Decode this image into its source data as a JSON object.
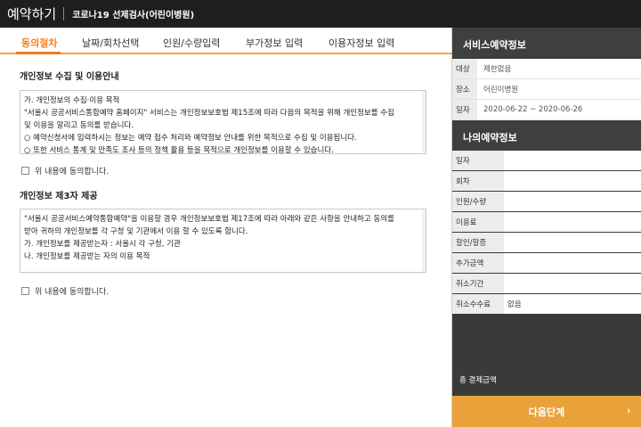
{
  "header": {
    "title": "예약하기",
    "subtitle": "코로나19 선제검사(어린이병원)"
  },
  "tabs": [
    {
      "label": "동의절차",
      "active": true
    },
    {
      "label": "날짜/회차선택",
      "active": false
    },
    {
      "label": "인원/수량입력",
      "active": false
    },
    {
      "label": "부가정보 입력",
      "active": false
    },
    {
      "label": "이용자정보 입력",
      "active": false
    }
  ],
  "consent1": {
    "title": "개인정보 수집 및 이용안내",
    "lines": [
      "가. 개인정보의 수집·이용 목적",
      "\"서울시 공공서비스통합예약 홈페이지\" 서비스는 개인정보보호법 제15조에 따라 다음의 목적을 위해 개인정보를 수집",
      "및 이용을 알리고 동의를 받습니다.",
      "",
      "○ 예약신청서에 입력하시는 정보는 예약 접수 처리와 예약정보 안내를 위한 목적으로 수집 및 이용됩니다.",
      "○ 또한 서비스 통계 및 만족도 조사 등의 정책 활용 등을 목적으로 개인정보를 이용할 수 있습니다."
    ],
    "agree_label": "위 내용에 동의합니다."
  },
  "consent2": {
    "title": "개인정보 제3자 제공",
    "lines": [
      "\"서울시 공공서비스예약통합예약\"을 이용할 경우 개인정보보호법 제17조에 따라 아래와 같은 사항을 안내하고 동의를",
      "받아 귀하의 개인정보를 각 구청 및 기관에서 이용 할 수 있도록 합니다.",
      "",
      "가. 개인정보를 제공받는자 : 서울시 각 구청, 기관",
      "",
      "나. 개인정보를 제공받는 자의 이용 목적"
    ],
    "agree_label": "위 내용에 동의합니다."
  },
  "service_info": {
    "title": "서비스예약정보",
    "rows": [
      {
        "key": "대상",
        "value": "제한없음"
      },
      {
        "key": "장소",
        "value": "어린이병원"
      },
      {
        "key": "일자",
        "value": "2020-06-22 ~ 2020-06-26"
      }
    ]
  },
  "my_info": {
    "title": "나의예약정보",
    "rows": [
      {
        "key": "일자",
        "value": ""
      },
      {
        "key": "회차",
        "value": ""
      },
      {
        "key": "인원/수량",
        "value": ""
      },
      {
        "key": "이용료",
        "value": ""
      },
      {
        "key": "할인/할증",
        "value": ""
      },
      {
        "key": "추가금액",
        "value": ""
      },
      {
        "key": "취소기간",
        "value": ""
      },
      {
        "key": "취소수수료",
        "value": "없음"
      }
    ]
  },
  "total_label": "총 결제금액",
  "next_button": "다음단계",
  "colors": {
    "accent": "#f07d1e",
    "button": "#e9a23a",
    "sidebar": "#3a3a3a",
    "topbar": "#1e1e1e"
  }
}
